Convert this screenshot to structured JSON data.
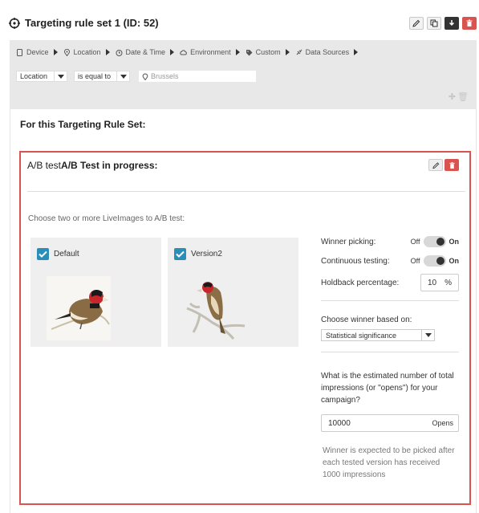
{
  "header": {
    "title": "Targeting rule set 1 (ID: 52)",
    "buttons": [
      "edit-icon",
      "copy-icon",
      "download-icon",
      "trash-icon"
    ]
  },
  "criteria": {
    "crumbs": [
      {
        "label": "Device",
        "icon": "device-icon"
      },
      {
        "label": "Location",
        "icon": "location-icon"
      },
      {
        "label": "Date & Time",
        "icon": "clock-icon"
      },
      {
        "label": "Environment",
        "icon": "cloud-icon"
      },
      {
        "label": "Custom",
        "icon": "tag-icon"
      },
      {
        "label": "Data Sources",
        "icon": "plug-icon"
      }
    ],
    "field": "Location",
    "operator": "is equal to",
    "value_placeholder": "Brussels"
  },
  "rule_set_title": "For this Targeting Rule Set:",
  "ab_test": {
    "heading_prefix": "A/B test",
    "heading_bold": "A/B Test in progress:",
    "instruction": "Choose two or more LiveImages to A/B test:",
    "variants": [
      {
        "label": "Default",
        "checked": true
      },
      {
        "label": "Version2",
        "checked": true
      }
    ],
    "settings": {
      "winner_picking_label": "Winner picking:",
      "continuous_testing_label": "Continuous testing:",
      "off_label": "Off",
      "on_label": "On",
      "winner_picking_state": "on",
      "continuous_testing_state": "on",
      "holdback_label": "Holdback percentage:",
      "holdback_value": "10",
      "holdback_unit": "%",
      "choose_winner_label": "Choose winner based on:",
      "choose_winner_value": "Statistical significance",
      "impressions_question": "What is the estimated number of total impressions (or \"opens\") for your campaign?",
      "impressions_value": "10000",
      "impressions_unit": "Opens",
      "note": "Winner is expected to be picked after each tested version has received 1000 impressions"
    }
  },
  "colors": {
    "accent_red": "#d9534f",
    "checkbox_blue": "#2a8fb8",
    "panel_grey": "#e8e8e8"
  }
}
